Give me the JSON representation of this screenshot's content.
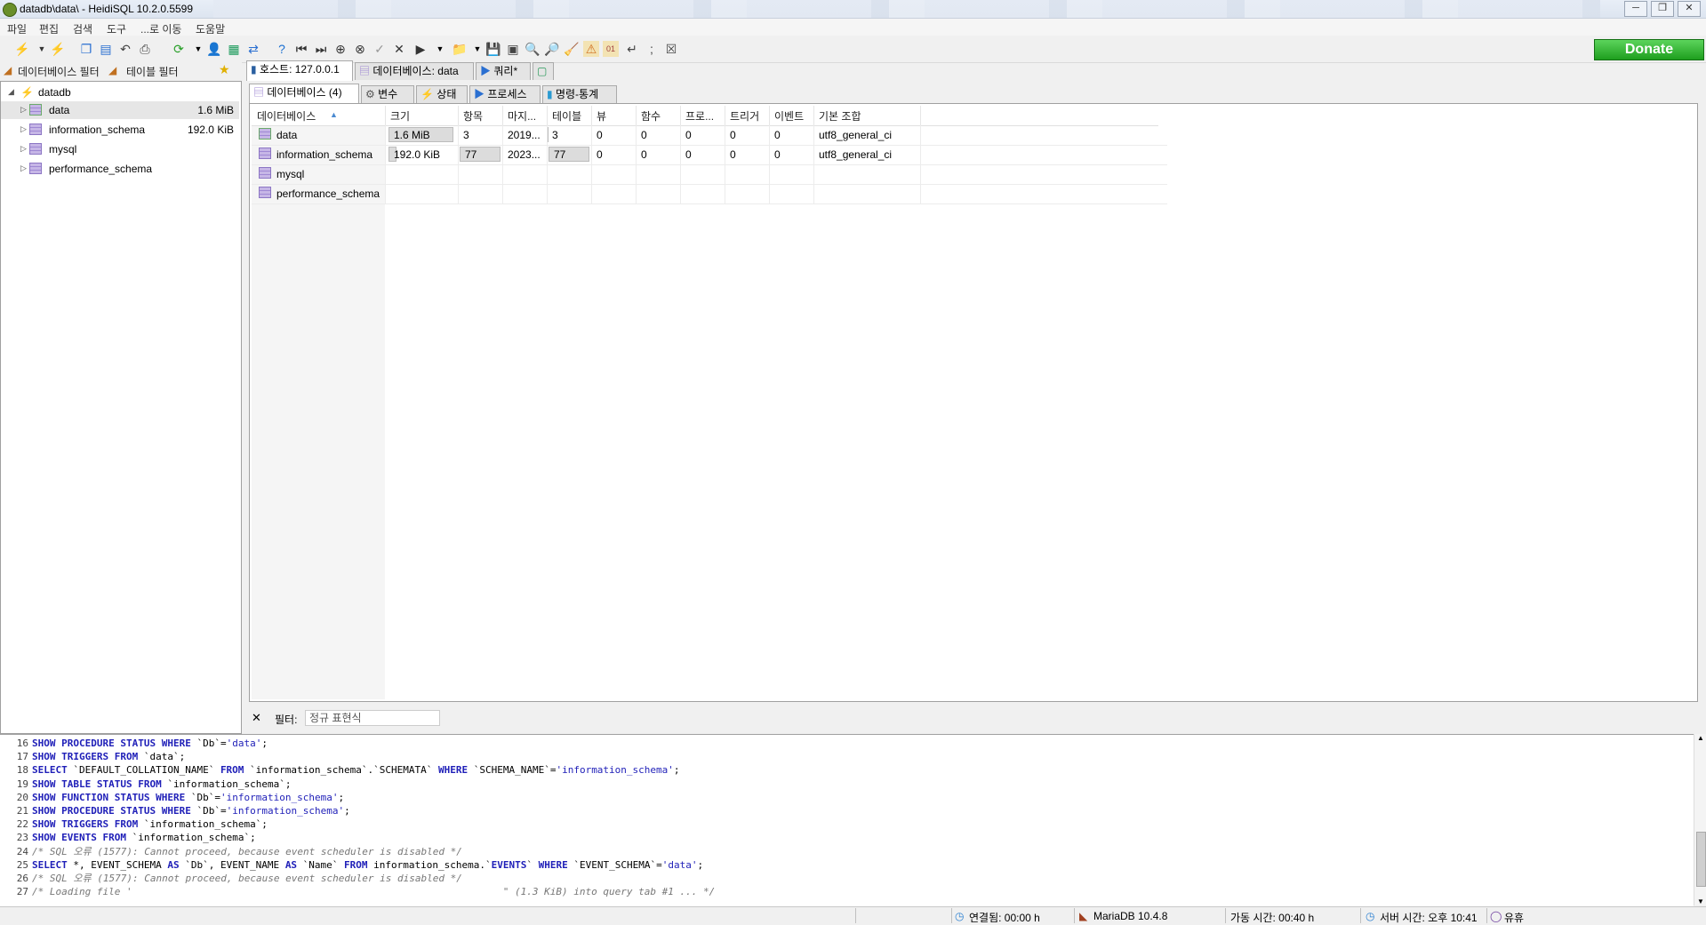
{
  "window": {
    "title": "datadb\\data\\ - HeidiSQL 10.2.0.5599",
    "controls": [
      "─",
      "❐",
      "✕"
    ]
  },
  "menu": [
    "파일",
    "편집",
    "검색",
    "도구",
    "...로 이동",
    "도움말"
  ],
  "toolbar": {
    "donate_label": "Donate"
  },
  "left_panel": {
    "db_filter_label": "데이터베이스 필터",
    "table_filter_label": "테이블 필터",
    "tree": {
      "root": "datadb",
      "items": [
        {
          "label": "data",
          "size": "1.6 MiB"
        },
        {
          "label": "information_schema",
          "size": "192.0 KiB"
        },
        {
          "label": "mysql",
          "size": ""
        },
        {
          "label": "performance_schema",
          "size": ""
        }
      ]
    }
  },
  "tabs": {
    "top": [
      "호스트: 127.0.0.1",
      "데이터베이스: data",
      "쿼리*"
    ],
    "sub": [
      "데이터베이스 (4)",
      "변수",
      "상태",
      "프로세스",
      "명령-통계"
    ]
  },
  "grid": {
    "columns": [
      "데이터베이스",
      "크기",
      "항목",
      "마지...",
      "테이블",
      "뷰",
      "함수",
      "프로...",
      "트리거",
      "이벤트",
      "기본 조합"
    ],
    "rows": [
      [
        "data",
        "1.6 MiB",
        "3",
        "2019...",
        "3",
        "0",
        "0",
        "0",
        "0",
        "0",
        "utf8_general_ci"
      ],
      [
        "information_schema",
        "192.0 KiB",
        "77",
        "2023...",
        "77",
        "0",
        "0",
        "0",
        "0",
        "0",
        "utf8_general_ci"
      ],
      [
        "mysql",
        "",
        "",
        "",
        "",
        "",
        "",
        "",
        "",
        "",
        ""
      ],
      [
        "performance_schema",
        "",
        "",
        "",
        "",
        "",
        "",
        "",
        "",
        "",
        ""
      ]
    ],
    "size_fill": [
      0.96,
      0.12
    ]
  },
  "filter": {
    "label": "필터:",
    "placeholder": "정규 표현식"
  },
  "sql_log": [
    {
      "n": "16",
      "text": "SHOW PROCEDURE STATUS WHERE `Db`='data';"
    },
    {
      "n": "17",
      "text": "SHOW TRIGGERS FROM `data`;"
    },
    {
      "n": "18",
      "text": "SELECT `DEFAULT_COLLATION_NAME` FROM `information_schema`.`SCHEMATA` WHERE `SCHEMA_NAME`='information_schema';"
    },
    {
      "n": "19",
      "text": "SHOW TABLE STATUS FROM `information_schema`;"
    },
    {
      "n": "20",
      "text": "SHOW FUNCTION STATUS WHERE `Db`='information_schema';"
    },
    {
      "n": "21",
      "text": "SHOW PROCEDURE STATUS WHERE `Db`='information_schema';"
    },
    {
      "n": "22",
      "text": "SHOW TRIGGERS FROM `information_schema`;"
    },
    {
      "n": "23",
      "text": "SHOW EVENTS FROM `information_schema`;"
    },
    {
      "n": "24",
      "text": "/* SQL 오류 (1577): Cannot proceed, because event scheduler is disabled */"
    },
    {
      "n": "25",
      "text": "SELECT *, EVENT_SCHEMA AS `Db`, EVENT_NAME AS `Name` FROM information_schema.`EVENTS` WHERE `EVENT_SCHEMA`='data';"
    },
    {
      "n": "26",
      "text": "/* SQL 오류 (1577): Cannot proceed, because event scheduler is disabled */"
    },
    {
      "n": "27",
      "text": "/* Loading file '                                                               \" (1.3 KiB) into query tab #1 ... */"
    }
  ],
  "status_bar": {
    "connected": "연결됨: 00:00 h",
    "server": "MariaDB 10.4.8",
    "uptime": "가동 시간: 00:40 h",
    "server_time": "서버 시간: 오후 10:41",
    "state": "유휴"
  }
}
